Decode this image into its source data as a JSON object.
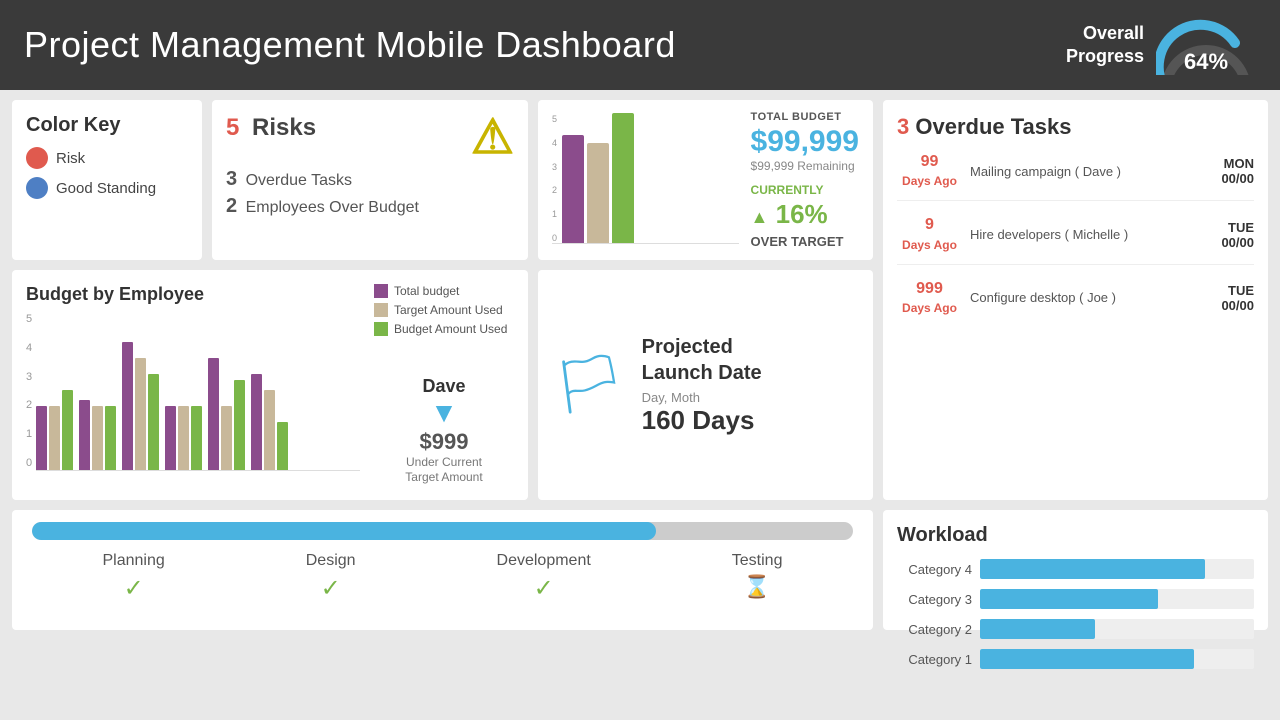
{
  "header": {
    "title": "Project Management Mobile Dashboard",
    "overall_progress_label": "Overall\nProgress",
    "overall_progress_pct": "64%"
  },
  "color_key": {
    "title": "Color Key",
    "items": [
      {
        "label": "Risk",
        "type": "risk"
      },
      {
        "label": "Good Standing",
        "type": "good"
      }
    ]
  },
  "risks": {
    "count": "5",
    "label": "Risks",
    "overdue_count": "3",
    "overdue_label": "Overdue Tasks",
    "over_budget_count": "2",
    "over_budget_label": "Employees Over Budget"
  },
  "budget_numbers": {
    "amount": "$99,999",
    "label": "TOTAL BUDGET",
    "remaining": "$99,999 Remaining",
    "pct": "16%",
    "pct_label": "CURRENTLY",
    "over_target": "OVER TARGET"
  },
  "budget_chart": {
    "title": "Budget by Employee",
    "legend": [
      {
        "label": "Total budget",
        "color": "#8b4c8c"
      },
      {
        "label": "Target Amount Used",
        "color": "#c8b89a"
      },
      {
        "label": "Budget Amount Used",
        "color": "#7ab648"
      }
    ],
    "y_labels": [
      "5",
      "4",
      "3",
      "2",
      "1",
      "0"
    ],
    "groups": [
      {
        "bars": [
          2,
          2,
          2.5
        ]
      },
      {
        "bars": [
          2.2,
          2,
          2
        ]
      },
      {
        "bars": [
          4,
          3.5,
          3
        ]
      },
      {
        "bars": [
          2,
          2,
          2
        ]
      },
      {
        "bars": [
          3.5,
          2,
          2.8
        ]
      },
      {
        "bars": [
          3,
          2.5,
          1.5
        ]
      }
    ],
    "dave": {
      "name": "Dave",
      "amount": "$999",
      "sub": "Under Current\nTarget Amount"
    }
  },
  "launch": {
    "title": "Projected\nLaunch Date",
    "date_label": "Day, Moth",
    "days": "160 Days"
  },
  "overdue_tasks": {
    "title": "Overdue Tasks",
    "count": "3",
    "tasks": [
      {
        "days": "99\nDays Ago",
        "name": "Mailing campaign ( Dave )",
        "day": "MON",
        "date": "00/00"
      },
      {
        "days": "9\nDays Ago",
        "name": "Hire developers ( Michelle )",
        "day": "TUE",
        "date": "00/00"
      },
      {
        "days": "999\nDays Ago",
        "name": "Configure desktop ( Joe )",
        "day": "TUE",
        "date": "00/00"
      }
    ]
  },
  "phases": {
    "progress_pct": 76,
    "items": [
      {
        "name": "Planning",
        "status": "done"
      },
      {
        "name": "Design",
        "status": "done"
      },
      {
        "name": "Development",
        "status": "done"
      },
      {
        "name": "Testing",
        "status": "pending"
      }
    ]
  },
  "workload": {
    "title": "Workload",
    "categories": [
      {
        "label": "Category 4",
        "pct": 82
      },
      {
        "label": "Category 3",
        "pct": 65
      },
      {
        "label": "Category 2",
        "pct": 42
      },
      {
        "label": "Category 1",
        "pct": 78
      }
    ]
  }
}
